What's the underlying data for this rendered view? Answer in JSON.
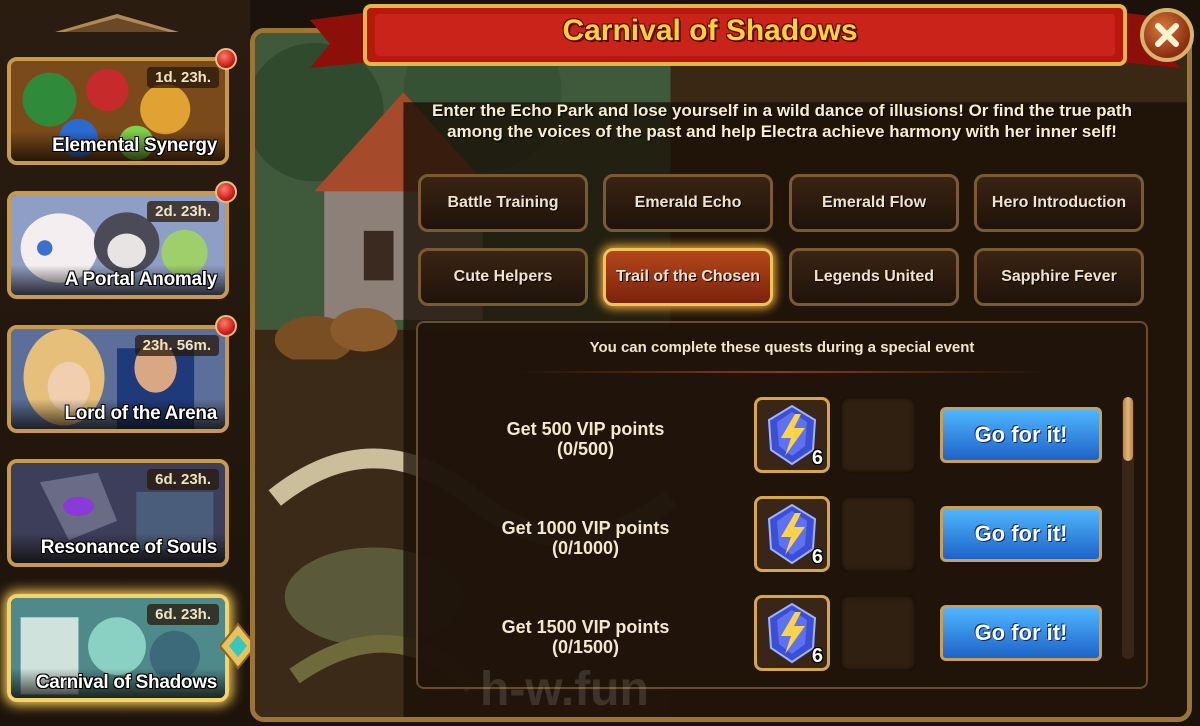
{
  "events": [
    {
      "title": "Elemental Synergy",
      "timer": "1d. 23h.",
      "has_notification": true
    },
    {
      "title": "A Portal Anomaly",
      "timer": "2d. 23h.",
      "has_notification": true
    },
    {
      "title": "Lord of the Arena",
      "timer": "23h. 56m.",
      "has_notification": true
    },
    {
      "title": "Resonance of Souls",
      "timer": "6d. 23h.",
      "has_notification": false
    },
    {
      "title": "Carnival of Shadows",
      "timer": "6d. 23h.",
      "has_notification": false,
      "selected": true
    }
  ],
  "panel": {
    "title": "Carnival of Shadows",
    "description": "Enter the Echo Park and lose yourself in a wild dance of illusions! Or find the true path among the voices of the past and help Electra achieve harmony with her inner self!",
    "close_icon": "close-x-icon"
  },
  "tabs": [
    {
      "label": "Battle Training"
    },
    {
      "label": "Emerald Echo"
    },
    {
      "label": "Emerald Flow"
    },
    {
      "label": "Hero Introduction"
    },
    {
      "label": "Cute Helpers"
    },
    {
      "label": "Trail of the Chosen",
      "active": true
    },
    {
      "label": "Legends United"
    },
    {
      "label": "Sapphire Fever"
    }
  ],
  "quests": {
    "header": "You can complete these quests during a special event",
    "items": [
      {
        "title": "Get 500 VIP points",
        "progress": "(0/500)",
        "reward_icon": "blue-lightning-gem-icon",
        "reward_qty": "6",
        "button": "Go for it!"
      },
      {
        "title": "Get 1000 VIP points",
        "progress": "(0/1000)",
        "reward_icon": "blue-lightning-gem-icon",
        "reward_qty": "6",
        "button": "Go for it!"
      },
      {
        "title": "Get 1500 VIP points",
        "progress": "(0/1500)",
        "reward_icon": "blue-lightning-gem-icon",
        "reward_qty": "6",
        "button": "Go for it!"
      }
    ]
  },
  "watermark": "h-w.fun",
  "colors": {
    "accent_gold": "#ffd23a",
    "ribbon_red": "#b8170e",
    "button_blue": "#2a7fe0",
    "active_tab": "#b4461a"
  }
}
